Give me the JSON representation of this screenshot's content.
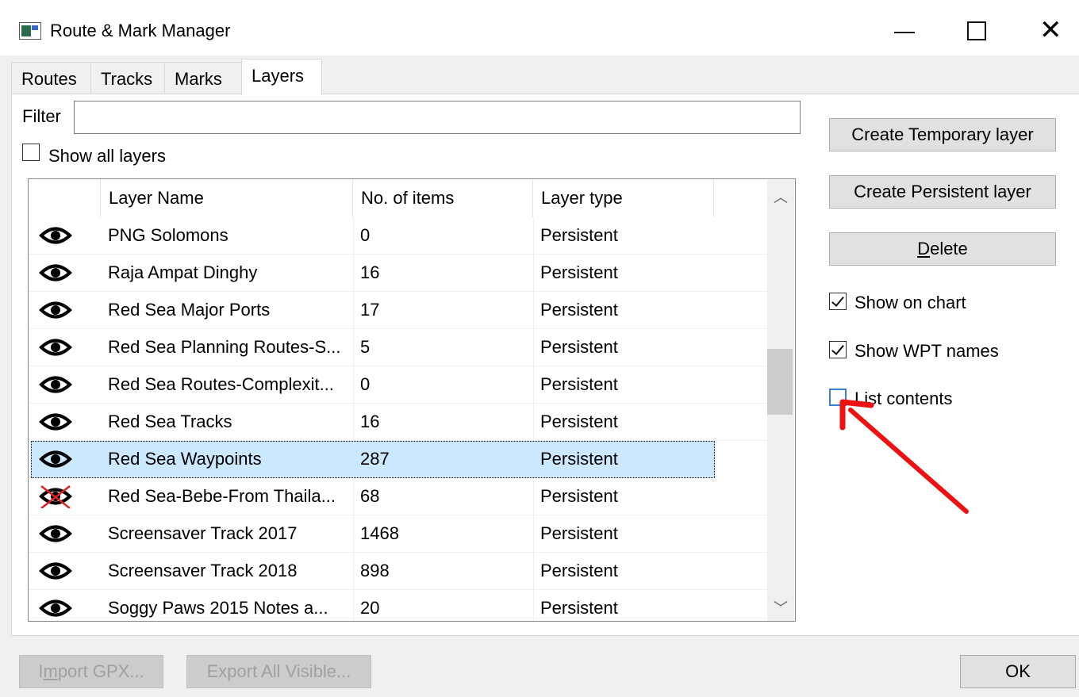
{
  "window": {
    "title": "Route & Mark Manager"
  },
  "tabs": [
    {
      "label": "Routes"
    },
    {
      "label": "Tracks"
    },
    {
      "label": "Marks"
    },
    {
      "label": "Layers",
      "active": true
    }
  ],
  "filter": {
    "label": "Filter",
    "value": ""
  },
  "show_all_layers": {
    "label": "Show all layers",
    "checked": false
  },
  "table": {
    "columns": [
      "",
      "Layer Name",
      "No. of items",
      "Layer type"
    ],
    "rows": [
      {
        "visible": true,
        "name": "PNG Solomons",
        "count": "0",
        "type": "Persistent"
      },
      {
        "visible": true,
        "name": "Raja Ampat Dinghy",
        "count": "16",
        "type": "Persistent"
      },
      {
        "visible": true,
        "name": "Red Sea Major Ports",
        "count": "17",
        "type": "Persistent"
      },
      {
        "visible": true,
        "name": "Red Sea Planning Routes-S...",
        "count": "5",
        "type": "Persistent"
      },
      {
        "visible": true,
        "name": "Red Sea Routes-Complexit...",
        "count": "0",
        "type": "Persistent"
      },
      {
        "visible": true,
        "name": "Red Sea Tracks",
        "count": "16",
        "type": "Persistent"
      },
      {
        "visible": true,
        "name": "Red Sea Waypoints",
        "count": "287",
        "type": "Persistent",
        "selected": true
      },
      {
        "visible": false,
        "name": "Red Sea-Bebe-From Thaila...",
        "count": "68",
        "type": "Persistent"
      },
      {
        "visible": true,
        "name": "Screensaver Track 2017",
        "count": "1468",
        "type": "Persistent"
      },
      {
        "visible": true,
        "name": "Screensaver Track 2018",
        "count": "898",
        "type": "Persistent"
      },
      {
        "visible": true,
        "name": "Soggy Paws 2015 Notes a...",
        "count": "20",
        "type": "Persistent"
      }
    ]
  },
  "side_buttons": {
    "create_temp": "Create Temporary layer",
    "create_persist": "Create Persistent layer",
    "delete": "Delete"
  },
  "options": {
    "show_on_chart": {
      "label": "Show on chart",
      "checked": true
    },
    "show_wpt_names": {
      "label": "Show WPT names",
      "checked": true
    },
    "list_contents": {
      "label": "List contents",
      "checked": false
    }
  },
  "bottom_buttons": {
    "import": "Import GPX...",
    "export": "Export All Visible...",
    "ok": "OK"
  },
  "annotation": {
    "color": "#ee1111",
    "icon": "red-arrow"
  }
}
